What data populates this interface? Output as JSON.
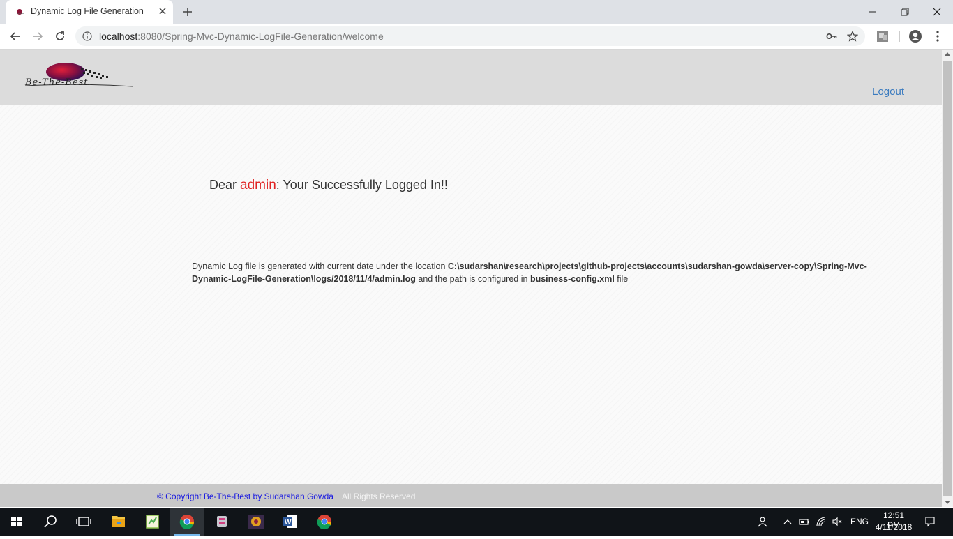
{
  "browser": {
    "tab_title": "Dynamic Log File Generation",
    "url_host": "localhost",
    "url_rest": ":8080/Spring-Mvc-Dynamic-LogFile-Generation/welcome"
  },
  "header": {
    "logout": "Logout"
  },
  "content": {
    "greeting_prefix": "Dear ",
    "username": "admin",
    "greeting_suffix": ": Your Successfully Logged In!!",
    "log_text_1": "Dynamic Log file is generated with current date under the location ",
    "log_path": "C:\\sudarshan\\research\\projects\\github-projects\\accounts\\sudarshan-gowda\\server-copy\\Spring-Mvc-Dynamic-LogFile-Generation\\logs/2018/11/4/admin.log",
    "log_text_2": " and the path is configured in ",
    "config_file": "business-config.xml",
    "log_text_3": " file"
  },
  "footer": {
    "copyright": "© Copyright Be-The-Best by Sudarshan Gowda",
    "rights": "All Rights Reserved"
  },
  "taskbar": {
    "language": "ENG",
    "time": "12:51 PM",
    "date": "4/11/2018"
  },
  "colors": {
    "accent_link": "#3b7bbf",
    "username_red": "#e02424",
    "footer_link": "#1a1ae0"
  }
}
